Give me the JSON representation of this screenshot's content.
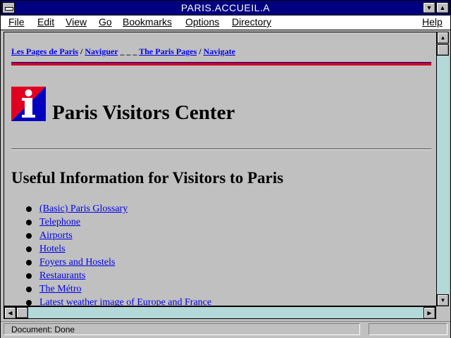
{
  "window": {
    "title": "PARIS.ACCUEIL.A"
  },
  "menu": {
    "file": "File",
    "edit": "Edit",
    "view": "View",
    "go": "Go",
    "bookmarks": "Bookmarks",
    "options": "Options",
    "directory": "Directory",
    "help": "Help"
  },
  "breadcrumb": {
    "link1": "Les Pages de Paris",
    "sep1": " / ",
    "link2": "Naviguer",
    "sep2": " _ _ _ ",
    "link3": "The Paris Pages",
    "sep3": " / ",
    "link4": "Navigate"
  },
  "page": {
    "logo_letter": "i",
    "title": "Paris Visitors Center",
    "section_heading": "Useful Information for Visitors to Paris",
    "links": [
      "(Basic) Paris Glossary",
      "Telephone",
      "Airports",
      "Hotels",
      "Foyers and Hostels",
      "Restaurants",
      "The Métro",
      "Latest weather image of Europe and France"
    ]
  },
  "status": {
    "text": "Document: Done"
  },
  "colors": {
    "titlebar": "#000080",
    "link": "#0000ee",
    "logo_red": "#e00020",
    "logo_blue": "#0000c0"
  }
}
